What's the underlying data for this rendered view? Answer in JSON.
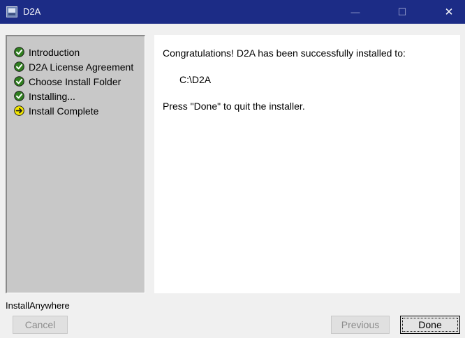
{
  "window": {
    "title": "D2A",
    "minimize_glyph": "—",
    "maximize_glyph": "☐",
    "close_glyph": "✕"
  },
  "steps": [
    {
      "label": "Introduction",
      "status": "done"
    },
    {
      "label": "D2A License Agreement",
      "status": "done"
    },
    {
      "label": "Choose Install Folder",
      "status": "done"
    },
    {
      "label": "Installing...",
      "status": "done"
    },
    {
      "label": "Install Complete",
      "status": "current"
    }
  ],
  "content": {
    "line1": "Congratulations! D2A has been successfully installed to:",
    "install_path": "C:\\D2A",
    "line2": "Press \"Done\" to quit the installer."
  },
  "footer": {
    "brand": "InstallAnywhere",
    "cancel_label": "Cancel",
    "previous_label": "Previous",
    "done_label": "Done"
  },
  "colors": {
    "titlebar": "#1c2c86",
    "done_check": "#2f7d1f",
    "current_arrow": "#f2e600"
  }
}
